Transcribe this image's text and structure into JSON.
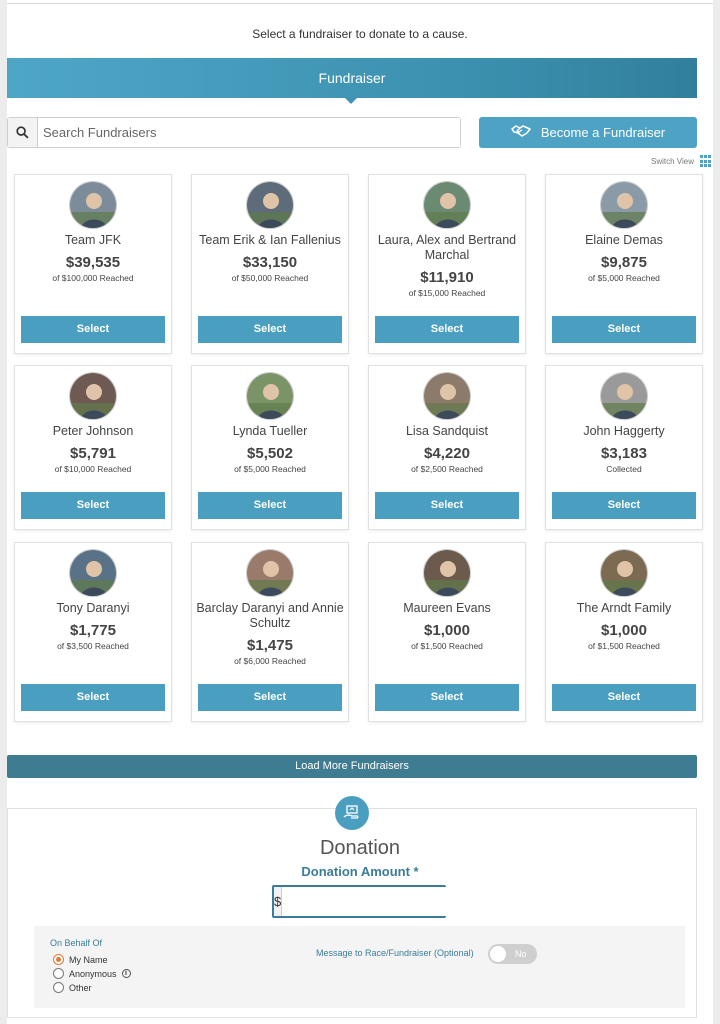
{
  "intro_text": "Select a fundraiser to donate to a cause.",
  "banner_title": "Fundraiser",
  "search": {
    "placeholder": "Search Fundraisers"
  },
  "become_label": "Become a Fundraiser",
  "switch_view_label": "Switch View",
  "select_label": "Select",
  "fundraisers": [
    {
      "name": "Team JFK",
      "amount": "$39,535",
      "goal": "of $100,000 Reached"
    },
    {
      "name": "Team Erik & Ian Fallenius",
      "amount": "$33,150",
      "goal": "of $50,000 Reached"
    },
    {
      "name": "Laura, Alex and Bertrand Marchal",
      "amount": "$11,910",
      "goal": "of $15,000 Reached"
    },
    {
      "name": "Elaine Demas",
      "amount": "$9,875",
      "goal": "of $5,000 Reached"
    },
    {
      "name": "Peter Johnson",
      "amount": "$5,791",
      "goal": "of $10,000 Reached"
    },
    {
      "name": "Lynda Tueller",
      "amount": "$5,502",
      "goal": "of $5,000 Reached"
    },
    {
      "name": "Lisa Sandquist",
      "amount": "$4,220",
      "goal": "of $2,500 Reached"
    },
    {
      "name": "John Haggerty",
      "amount": "$3,183",
      "goal": "Collected"
    },
    {
      "name": "Tony Daranyi",
      "amount": "$1,775",
      "goal": "of $3,500 Reached"
    },
    {
      "name": "Barclay Daranyi and Annie Schultz",
      "amount": "$1,475",
      "goal": "of $6,000 Reached"
    },
    {
      "name": "Maureen Evans",
      "amount": "$1,000",
      "goal": "of $1,500 Reached"
    },
    {
      "name": "The Arndt Family",
      "amount": "$1,000",
      "goal": "of $1,500 Reached"
    }
  ],
  "load_more_label": "Load More Fundraisers",
  "donation": {
    "title": "Donation",
    "amount_label": "Donation Amount *",
    "currency_symbol": "$",
    "on_behalf_title": "On Behalf Of",
    "behalf_options": [
      "My Name",
      "Anonymous",
      "Other"
    ],
    "behalf_selected": "My Name",
    "message_label": "Message to Race/Fundraiser (Optional)",
    "message_toggle": "No"
  },
  "colors": {
    "primary": "#4a9fc1",
    "dark_bar": "#3e7c92",
    "accent_text": "#3a7d98",
    "radio_selected": "#e07a3a"
  }
}
